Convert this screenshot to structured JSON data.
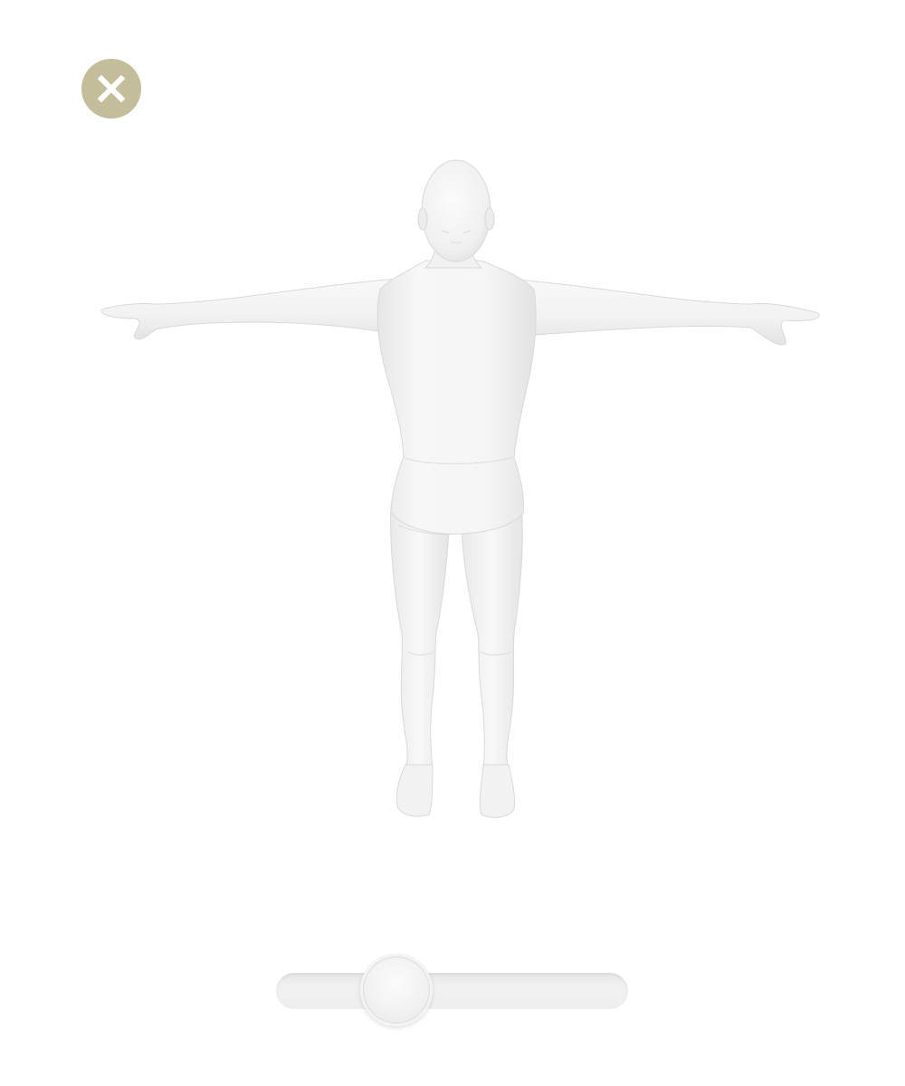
{
  "close_button": {
    "icon": "close-icon",
    "color": "#c3bd9c",
    "glyph_color": "#ffffff"
  },
  "model_viewer": {
    "subject": "human-body-model",
    "pose": "t-pose",
    "body_color": "#f4f4f4",
    "shade_color": "#dedede"
  },
  "rotation_slider": {
    "value": 0.3,
    "track_color": "#eeeeee",
    "thumb_color": "#f3f3f3"
  }
}
